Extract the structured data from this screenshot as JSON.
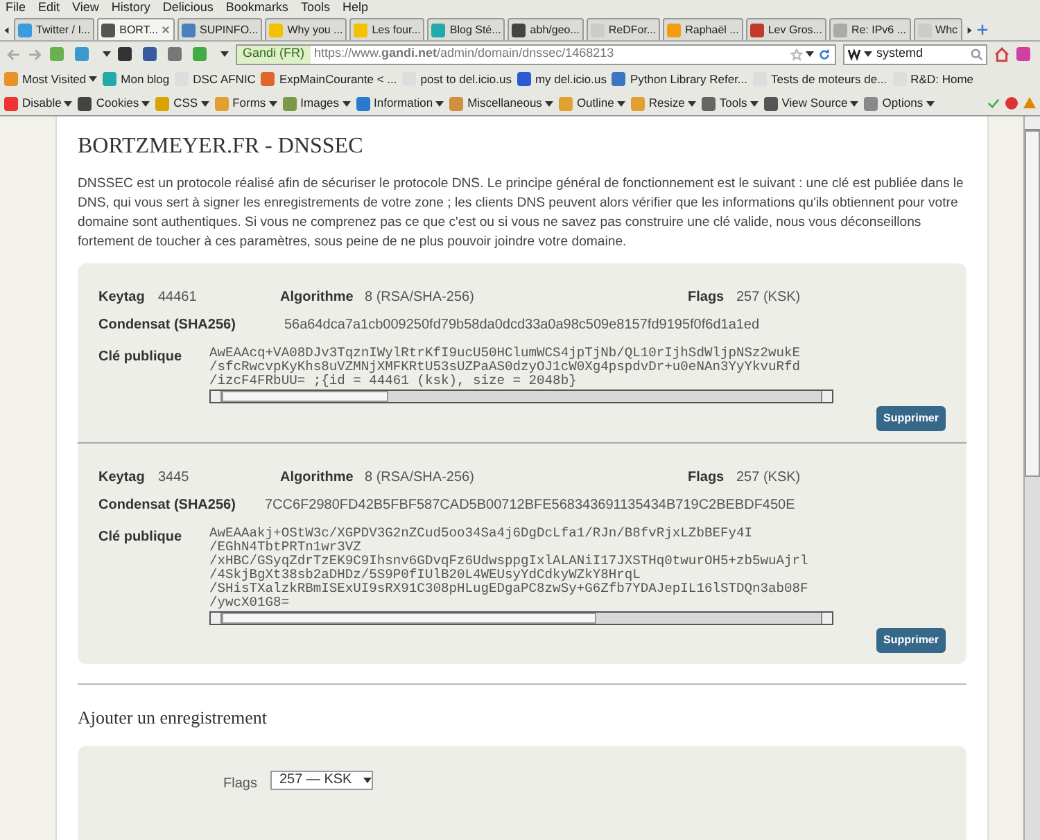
{
  "menu": [
    "File",
    "Edit",
    "View",
    "History",
    "Delicious",
    "Bookmarks",
    "Tools",
    "Help"
  ],
  "tabs": [
    {
      "label": "Twitter / I...",
      "selected": false
    },
    {
      "label": "BORT...",
      "selected": true
    },
    {
      "label": "SUPINFO...",
      "selected": false
    },
    {
      "label": "Why you ...",
      "selected": false
    },
    {
      "label": "Les four...",
      "selected": false
    },
    {
      "label": "Blog Sté...",
      "selected": false
    },
    {
      "label": "abh/geo...",
      "selected": false
    },
    {
      "label": "ReDFor...",
      "selected": false
    },
    {
      "label": "Raphaël ...",
      "selected": false
    },
    {
      "label": "Lev Gros...",
      "selected": false
    },
    {
      "label": "Re: IPv6 ...",
      "selected": false
    },
    {
      "label": "Whc",
      "selected": false
    }
  ],
  "navbar": {
    "site_identity": "Gandi (FR)",
    "url": "https://www.**gandi.net**/admin/domain/dnssec/1468213",
    "search_value": "systemd"
  },
  "bookmarks": [
    "Most Visited",
    "Mon blog",
    "DSC AFNIC",
    "ExpMainCourante < ...",
    "post to del.icio.us",
    "my del.icio.us",
    "Python Library Refer...",
    "Tests de moteurs de...",
    "R&D: Home"
  ],
  "dev_toolbar": [
    "Disable",
    "Cookies",
    "CSS",
    "Forms",
    "Images",
    "Information",
    "Miscellaneous",
    "Outline",
    "Resize",
    "Tools",
    "View Source",
    "Options"
  ],
  "page": {
    "title": "BORTZMEYER.FR - DNSSEC",
    "intro": "DNSSEC est un protocole réalisé afin de sécuriser le protocole DNS. Le principe général de fonctionnement est le suivant : une clé est publiée dans le DNS, qui vous sert à signer les enregistrements de votre zone ; les clients DNS peuvent alors vérifier que les informations qu'ils obtiennent pour votre domaine sont authentiques. Si vous ne comprenez pas ce que c'est ou si vous ne savez pas construire une clé valide, nous vous déconseillons fortement de toucher à ces paramètres, sous peine de ne plus pouvoir joindre votre domaine.",
    "keys": [
      {
        "keytag_label": "Keytag",
        "keytag": "44461",
        "algorithm_label": "Algorithme",
        "algorithm": "8 (RSA/SHA-256)",
        "flags_label": "Flags",
        "flags": "257 (KSK)",
        "digest_label": "Condensat (SHA256)",
        "digest": "56a64dca7a1cb009250fd79b58da0dcd33a0a98c509e8157fd9195f0f6d1a1ed",
        "public_key_label": "Clé publique",
        "public_key": [
          "AwEAAcq+VA08DJv3TqznIWylRtrKfI9ucU50HClumWCS4jpTjNb/QL10rIjhSdWljpNSz2wukE",
          "/sfcRwcvpKyKhs8uVZMNjXMFKRtU53sUZPaAS0dzyOJ1cW0Xg4pspdvDr+u0eNAn3YyYkvuRfd",
          "/izcF4FRbUU= ;{id = 44461 (ksk), size = 2048b}"
        ],
        "delete_button": "Supprimer"
      },
      {
        "keytag_label": "Keytag",
        "keytag": "3445",
        "algorithm_label": "Algorithme",
        "algorithm": "8 (RSA/SHA-256)",
        "flags_label": "Flags",
        "flags": "257 (KSK)",
        "digest_label": "Condensat (SHA256)",
        "digest": "7CC6F2980FD42B5FBF587CAD5B00712BFE568343691135434B719C2BEBDF450E",
        "public_key_label": "Clé publique",
        "public_key": [
          "AwEAAakj+OStW3c/XGPDV3G2nZCud5oo34Sa4j6DgDcLfa1/RJn/B8fvRjxLZbBEFy4I",
          "/EGhN4TbtPRTn1wr3VZ",
          "/xHBC/GSyqZdrTzEK9C9Ihsnv6GDvqFz6UdwsppgIxlALANiI17JXSTHq0twurOH5+zb5wuAjrl",
          "/4SkjBgXt38sb2aDHDz/5S9P0fIUlB20L4WEUsyYdCdkyWZkY8HrqL",
          "/SHisTXalzkRBmISExUI9sRX91C308pHLugEDgaPC8zwSy+G6Zfb7YDAJepIL16lSTDQn3ab08F",
          "/ywcX01G8="
        ],
        "delete_button": "Supprimer"
      }
    ],
    "add_title": "Ajouter un enregistrement",
    "form": {
      "flags_label": "Flags",
      "flags_value": "257 — KSK"
    }
  }
}
